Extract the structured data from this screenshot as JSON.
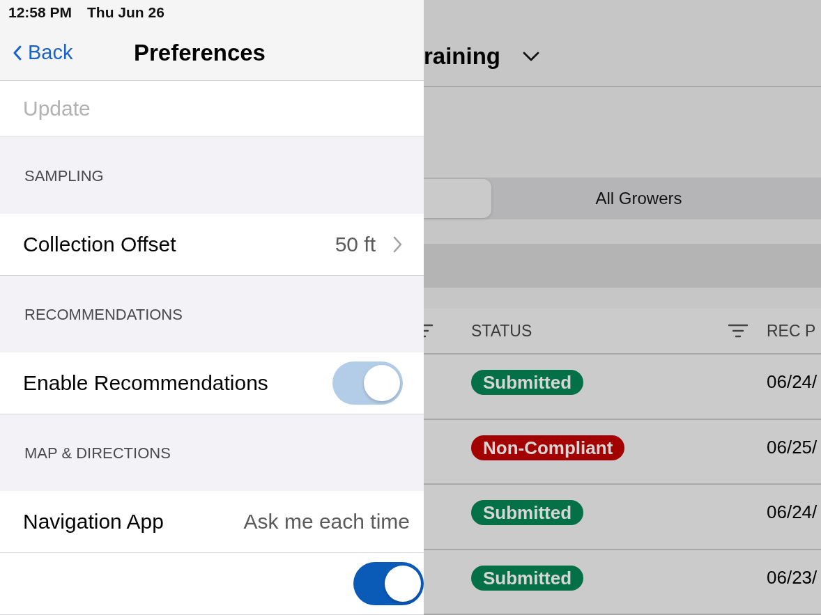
{
  "status_bar": {
    "time": "12:58 PM",
    "date": "Thu Jun 26"
  },
  "preferences": {
    "back": "Back",
    "title": "Preferences",
    "update": {
      "label": "Update",
      "disabled": true
    },
    "sections": [
      {
        "header": "SAMPLING",
        "rows": [
          {
            "kind": "disclosure",
            "label": "Collection Offset",
            "value": "50 ft"
          }
        ]
      },
      {
        "header": "RECOMMENDATIONS",
        "rows": [
          {
            "kind": "toggle",
            "label": "Enable Recommendations",
            "on": true,
            "disabled": true
          }
        ]
      },
      {
        "header": "MAP & DIRECTIONS",
        "rows": [
          {
            "kind": "value",
            "label": "Navigation App",
            "value": "Ask me each time"
          },
          {
            "kind": "toggle",
            "on": true,
            "disabled": false
          }
        ]
      }
    ]
  },
  "main": {
    "title": "raining",
    "segments": [
      {
        "selected": true
      },
      {
        "label": "All Growers",
        "selected": false
      }
    ],
    "table": {
      "columns": [
        {
          "filter": true
        },
        {
          "label": "STATUS",
          "filter": true
        },
        {
          "label": "REC P",
          "filter": false
        }
      ],
      "rows": [
        {
          "status": "Submitted",
          "color": "#047048",
          "date": "06/24/"
        },
        {
          "status": "Non-Compliant",
          "color": "#a30000",
          "date": "06/25/"
        },
        {
          "status": "Submitted",
          "color": "#047048",
          "date": "06/24/"
        },
        {
          "status": "Submitted",
          "color": "#047048",
          "date": "06/23/"
        }
      ]
    }
  }
}
